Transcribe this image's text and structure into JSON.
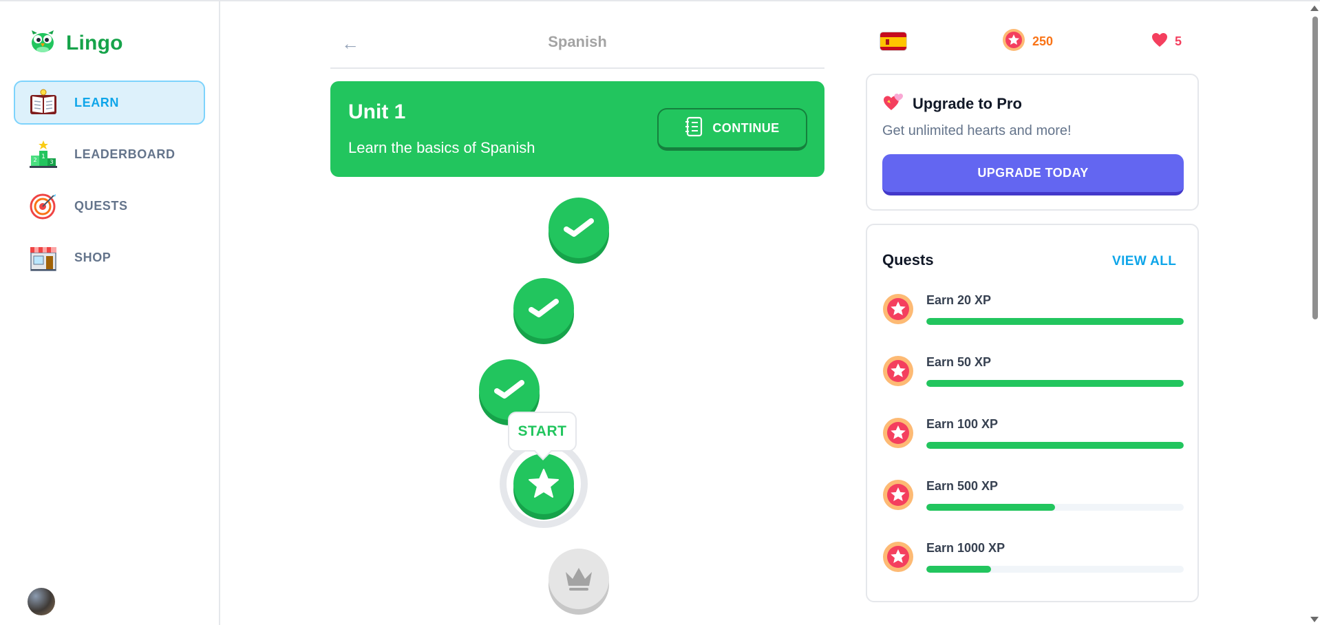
{
  "app": {
    "name": "Lingo"
  },
  "sidebar": {
    "items": [
      {
        "label": "LEARN",
        "icon": "book-icon",
        "active": true
      },
      {
        "label": "LEADERBOARD",
        "icon": "podium-icon",
        "active": false
      },
      {
        "label": "QUESTS",
        "icon": "target-icon",
        "active": false
      },
      {
        "label": "SHOP",
        "icon": "shop-icon",
        "active": false
      }
    ]
  },
  "header": {
    "title": "Spanish",
    "back_icon": "arrow-left-icon"
  },
  "unit": {
    "title": "Unit 1",
    "description": "Learn the basics of Spanish",
    "continue_label": "CONTINUE"
  },
  "path": {
    "start_label": "START",
    "lessons": [
      {
        "state": "completed",
        "icon": "check-icon"
      },
      {
        "state": "completed",
        "icon": "check-icon"
      },
      {
        "state": "completed",
        "icon": "check-icon"
      },
      {
        "state": "current",
        "icon": "star-icon"
      },
      {
        "state": "locked",
        "icon": "crown-icon"
      }
    ]
  },
  "stats": {
    "language_flag": "spain-flag-icon",
    "points": "250",
    "hearts": "5"
  },
  "promo": {
    "title": "Upgrade to Pro",
    "subtitle": "Get unlimited hearts and more!",
    "button_label": "UPGRADE TODAY"
  },
  "quests": {
    "title": "Quests",
    "view_all_label": "VIEW ALL",
    "items": [
      {
        "label": "Earn 20 XP",
        "progress": 1.0
      },
      {
        "label": "Earn 50 XP",
        "progress": 1.0
      },
      {
        "label": "Earn 100 XP",
        "progress": 1.0
      },
      {
        "label": "Earn 500 XP",
        "progress": 0.5
      },
      {
        "label": "Earn 1000 XP",
        "progress": 0.25
      }
    ]
  },
  "colors": {
    "brand_green": "#22c55e",
    "accent_blue": "#0ea5e9",
    "pro_purple": "#6366f1",
    "points_orange": "#f97316",
    "hearts_red": "#f43f5e"
  }
}
